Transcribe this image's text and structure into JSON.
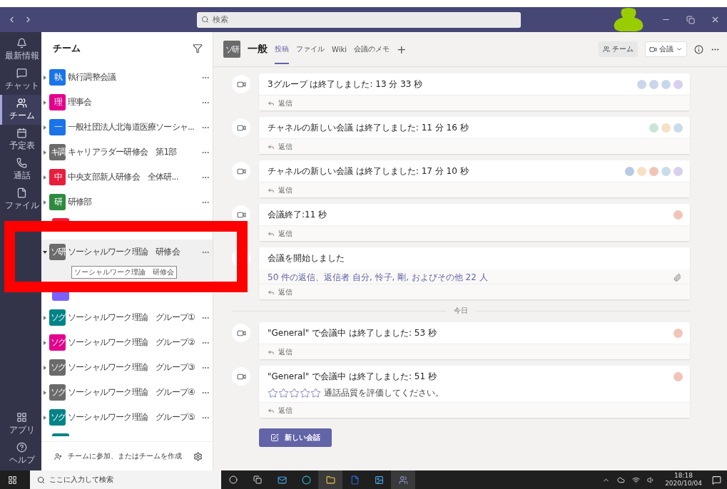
{
  "titlebar": {
    "search": {
      "placeholder": "検索"
    }
  },
  "rail": {
    "items": [
      {
        "label": "最新情報",
        "kind": "bell",
        "selected": false
      },
      {
        "label": "チャット",
        "kind": "chat",
        "selected": false
      },
      {
        "label": "チーム",
        "kind": "teams",
        "selected": true
      },
      {
        "label": "予定表",
        "kind": "calendar",
        "selected": false
      },
      {
        "label": "通話",
        "kind": "phone",
        "selected": false
      },
      {
        "label": "ファイル",
        "kind": "file",
        "selected": false
      }
    ],
    "bottom": [
      {
        "label": "アプリ",
        "kind": "apps"
      },
      {
        "label": "ヘルプ",
        "kind": "help"
      }
    ]
  },
  "teams_panel": {
    "title": "チーム",
    "teams": [
      {
        "name": "執行調整会議",
        "avatar": "執",
        "color": "#1a73e8",
        "selected": false,
        "expanded": false
      },
      {
        "name": "理事会",
        "avatar": "理",
        "color": "#e3008c",
        "selected": false,
        "expanded": false
      },
      {
        "name": "一般社団法人北海道医療ソーシャ...",
        "avatar": "一",
        "color": "#1a73e8",
        "selected": false,
        "expanded": false
      },
      {
        "name": "キャリアラダー研修会　第1部",
        "avatar": "キ調",
        "color": "#6b6b6b",
        "selected": false,
        "expanded": false
      },
      {
        "name": "中央支部新人研修会　全体研...",
        "avatar": "中",
        "color": "#e81e3c",
        "selected": false,
        "expanded": false
      },
      {
        "name": "研修部",
        "avatar": "研",
        "color": "#2e8b3e",
        "selected": false,
        "expanded": false
      },
      {
        "covered": true,
        "color": "#e81e3c"
      },
      {
        "name": "ソーシャルワーク理論　研修会",
        "avatar": "ソ研",
        "color": "#6b6b6b",
        "selected": true,
        "expanded": true,
        "tooltip": "ソーシャルワーク理論　研修会"
      },
      {
        "covered": true,
        "color": "#7b61ff"
      },
      {
        "name": "ソーシャルワーク理論　グループ①",
        "avatar": "ソグ",
        "color": "#038387",
        "selected": false,
        "expanded": false
      },
      {
        "name": "ソーシャルワーク理論　グループ②",
        "avatar": "ソグ",
        "color": "#e3008c",
        "selected": false,
        "expanded": false
      },
      {
        "name": "ソーシャルワーク理論　グループ③",
        "avatar": "ソグ",
        "color": "#6b6b6b",
        "selected": false,
        "expanded": false
      },
      {
        "name": "ソーシャルワーク理論　グループ④",
        "avatar": "ソグ",
        "color": "#6b6b6b",
        "selected": false,
        "expanded": false
      },
      {
        "name": "ソーシャルワーク理論　グループ⑤",
        "avatar": "ソグ",
        "color": "#038387",
        "selected": false,
        "expanded": false
      },
      {
        "covered": true,
        "color": "#038387"
      }
    ],
    "footer": "チームに参加、またはチームを作成"
  },
  "channel": {
    "avatar": "ソ研",
    "name": "一般",
    "tabs": [
      {
        "label": "投稿",
        "selected": true
      },
      {
        "label": "ファイル",
        "selected": false
      },
      {
        "label": "Wiki",
        "selected": false
      },
      {
        "label": "会議のメモ",
        "selected": false
      }
    ],
    "add": "+",
    "team_button": "チーム",
    "meet_button": "会議"
  },
  "messages": [
    {
      "kind": "meeting",
      "text": "3グループ は終了しました: 13 分 33 秒",
      "reply": "返信",
      "participants": [
        {
          "color": "#c9d6ec"
        },
        {
          "color": "#c9d6ec"
        },
        {
          "color": "#c9d6ec"
        },
        {
          "color": "#d6d0ec"
        }
      ]
    },
    {
      "kind": "meeting",
      "text": "チャネルの新しい会議 は終了しました: 11 分 16 秒",
      "reply": "返信",
      "participants": [
        {
          "color": "#c8e6d6"
        },
        {
          "color": "#f6e1c4"
        },
        {
          "color": "#c9dcec"
        }
      ]
    },
    {
      "kind": "meeting",
      "text": "チャネルの新しい会議 は終了しました: 17 分 10 秒",
      "reply": "返信",
      "participants": [
        {
          "color": "#b9c9e8"
        },
        {
          "color": "#f6e1c4"
        },
        {
          "color": "#f1c4b8"
        },
        {
          "color": "#c9dcec"
        },
        {
          "color": "#d6d0ec"
        }
      ]
    },
    {
      "kind": "meeting",
      "text": "会議終了:11 秒",
      "reply": "返信",
      "participants": [
        {
          "color": "#f1c4b8"
        }
      ]
    },
    {
      "kind": "started",
      "text": "会議を開始しました",
      "summary": "50 件の返信、返信者 自分, 怜子, 剛, およびその他 22 人",
      "reply": "返信"
    },
    {
      "kind": "divider",
      "text": "今日"
    },
    {
      "kind": "meeting",
      "text": "\"General\" で会議中 は終了しました: 53 秒",
      "reply": "返信",
      "participants": [
        {
          "color": "#f1c4b8"
        }
      ]
    },
    {
      "kind": "rating",
      "text": "\"General\" で会議中 は終了しました: 51 秒",
      "stars": 0,
      "prompt": "通話品質を評価してください。",
      "reply": "返信",
      "participants": [
        {
          "color": "#f1c4b8"
        }
      ]
    }
  ],
  "new_conversation": "新しい会話",
  "taskbar": {
    "search": {
      "placeholder": "ここに入力して検索"
    },
    "time": "18:18",
    "date": "2020/10/04"
  }
}
